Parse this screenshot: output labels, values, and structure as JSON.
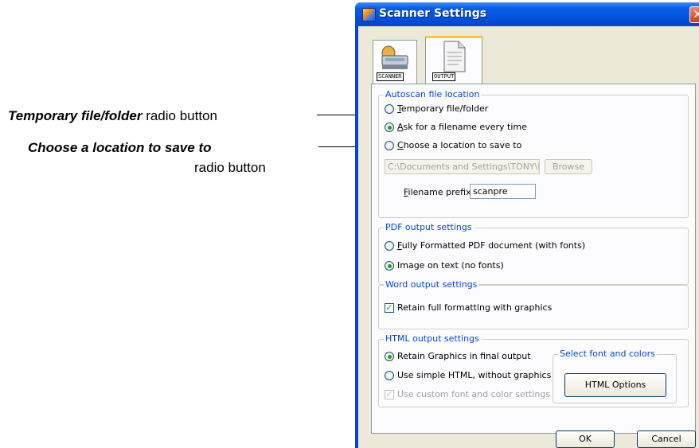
{
  "callouts": {
    "temporary": {
      "bold": "Temporary file/folder",
      "rest": " radio button"
    },
    "choose": {
      "bold": "Choose a location to save to",
      "line2": "radio button"
    }
  },
  "window": {
    "title": "Scanner Settings",
    "close": "✕"
  },
  "tabs": [
    {
      "label": "SCANNER",
      "icon": "scanner-icon"
    },
    {
      "label": "OUTPUT",
      "icon": "document-icon",
      "active": true
    }
  ],
  "autoscan": {
    "legend": "Autoscan file location",
    "temporary": "Temporary file/folder",
    "ask": "Ask for a filename every time",
    "choose": "Choose a location to save to",
    "path": "C:\\Documents and Settings\\TONY\\M",
    "browse": "Browse",
    "prefix_label": "Filename prefix",
    "prefix_value": "scanpre"
  },
  "pdf": {
    "legend": "PDF output settings",
    "full": "Fully Formatted PDF document (with fonts)",
    "image": "Image on text (no fonts)"
  },
  "word": {
    "legend": "Word output settings",
    "retain": "Retain full formatting with graphics"
  },
  "html": {
    "legend": "HTML output settings",
    "retain_graphics": "Retain Graphics in final output",
    "simple": "Use simple HTML, without graphics",
    "custom": "Use custom font and color settings",
    "font_legend": "Select font and colors",
    "options_button": "HTML Options"
  },
  "footer": {
    "ok": "OK",
    "cancel": "Cancel"
  },
  "colors": {
    "accent": "#0046d5",
    "titlebar": "#0a5ce8",
    "face": "#ece9d8"
  }
}
